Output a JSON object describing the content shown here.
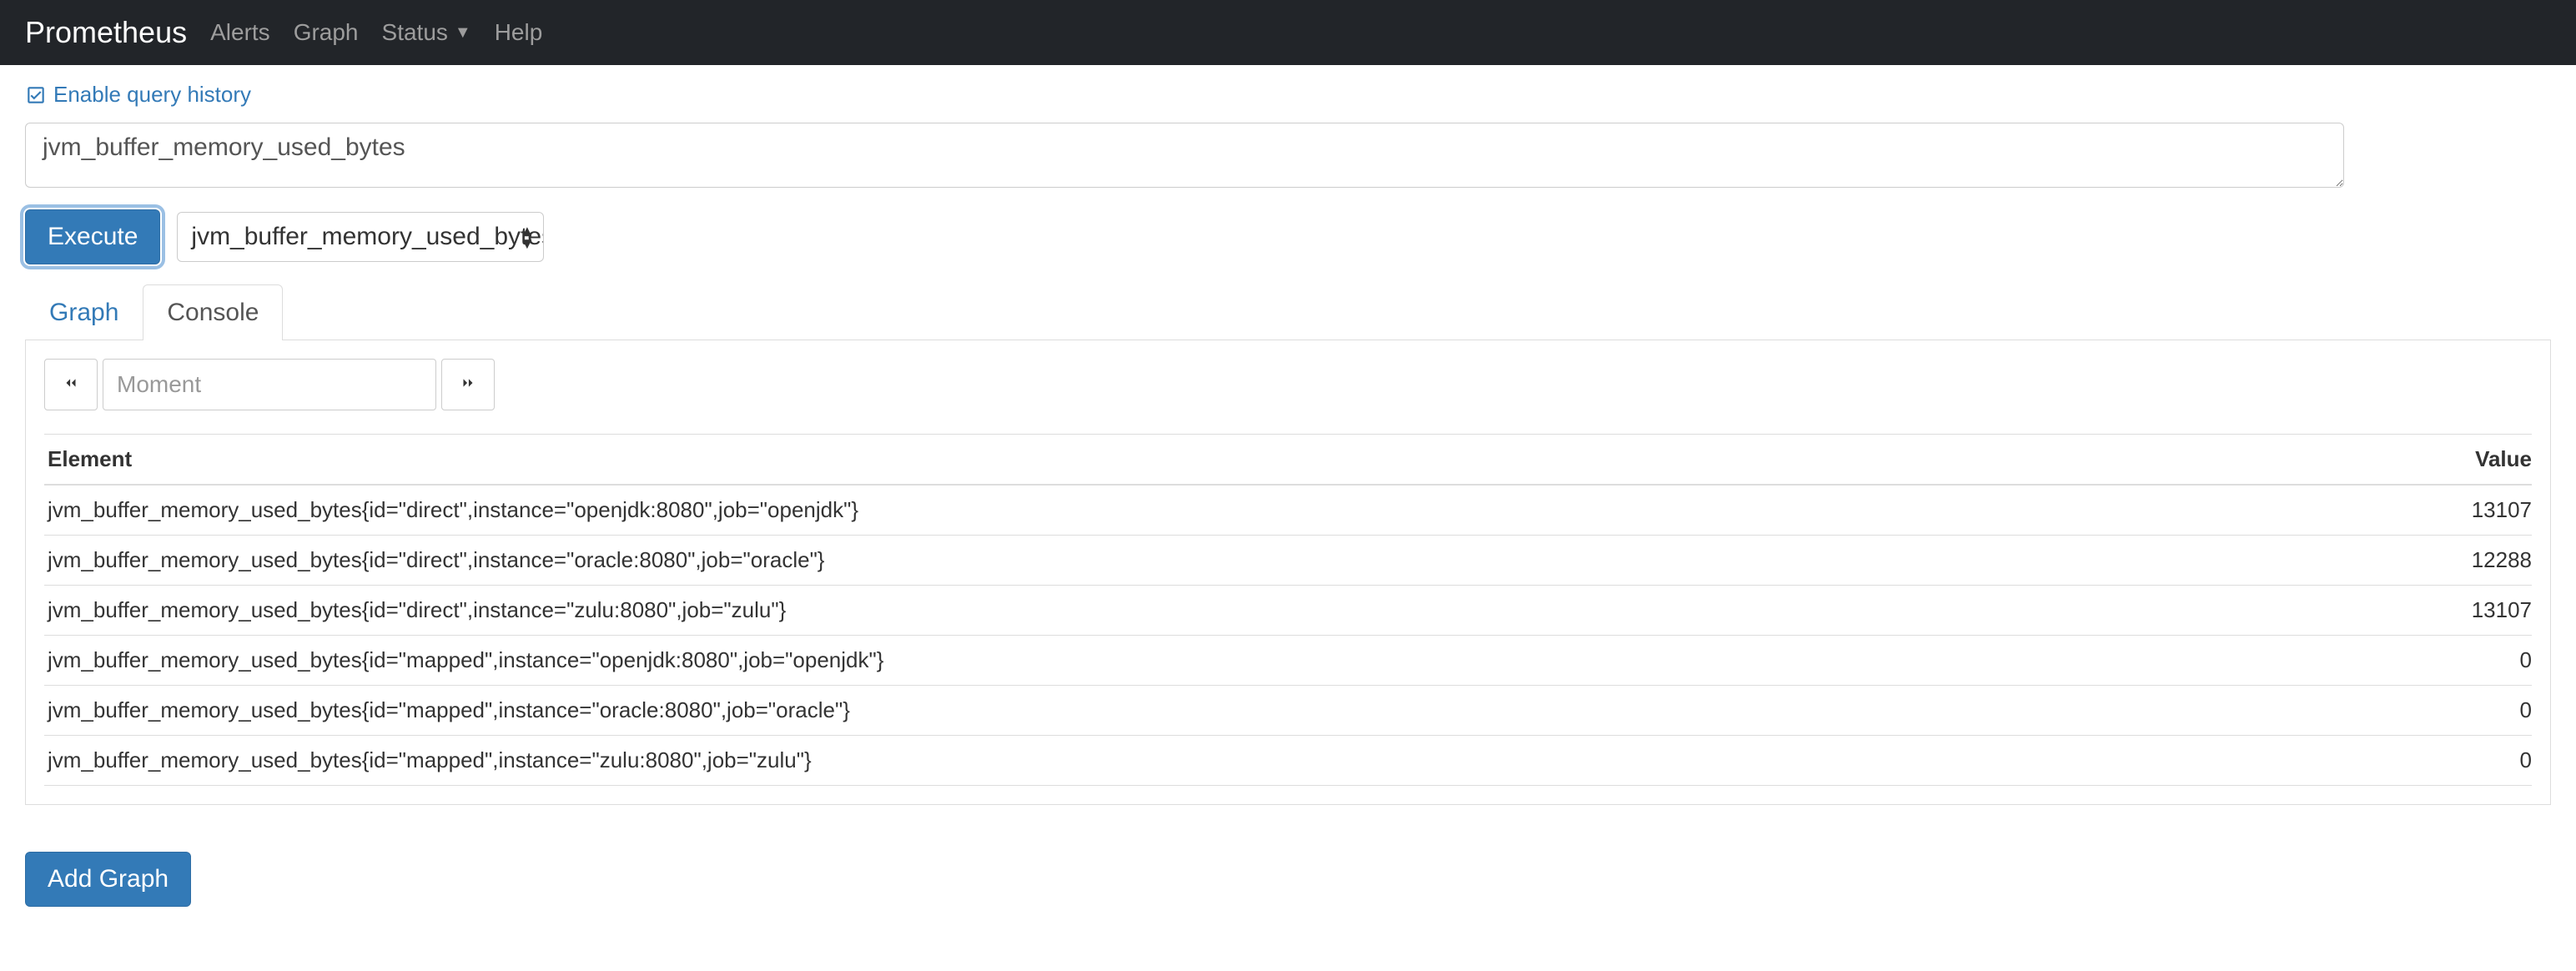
{
  "navbar": {
    "brand": "Prometheus",
    "items": [
      "Alerts",
      "Graph",
      "Status",
      "Help"
    ]
  },
  "history_toggle": "Enable query history",
  "query_value": "jvm_buffer_memory_used_bytes",
  "execute_label": "Execute",
  "metric_select_value": "jvm_buffer_memory_used_bytes",
  "tabs": {
    "graph": "Graph",
    "console": "Console"
  },
  "moment_placeholder": "Moment",
  "table": {
    "headers": {
      "element": "Element",
      "value": "Value"
    },
    "rows": [
      {
        "element": "jvm_buffer_memory_used_bytes{id=\"direct\",instance=\"openjdk:8080\",job=\"openjdk\"}",
        "value": "13107"
      },
      {
        "element": "jvm_buffer_memory_used_bytes{id=\"direct\",instance=\"oracle:8080\",job=\"oracle\"}",
        "value": "12288"
      },
      {
        "element": "jvm_buffer_memory_used_bytes{id=\"direct\",instance=\"zulu:8080\",job=\"zulu\"}",
        "value": "13107"
      },
      {
        "element": "jvm_buffer_memory_used_bytes{id=\"mapped\",instance=\"openjdk:8080\",job=\"openjdk\"}",
        "value": "0"
      },
      {
        "element": "jvm_buffer_memory_used_bytes{id=\"mapped\",instance=\"oracle:8080\",job=\"oracle\"}",
        "value": "0"
      },
      {
        "element": "jvm_buffer_memory_used_bytes{id=\"mapped\",instance=\"zulu:8080\",job=\"zulu\"}",
        "value": "0"
      }
    ]
  },
  "add_graph_label": "Add Graph"
}
